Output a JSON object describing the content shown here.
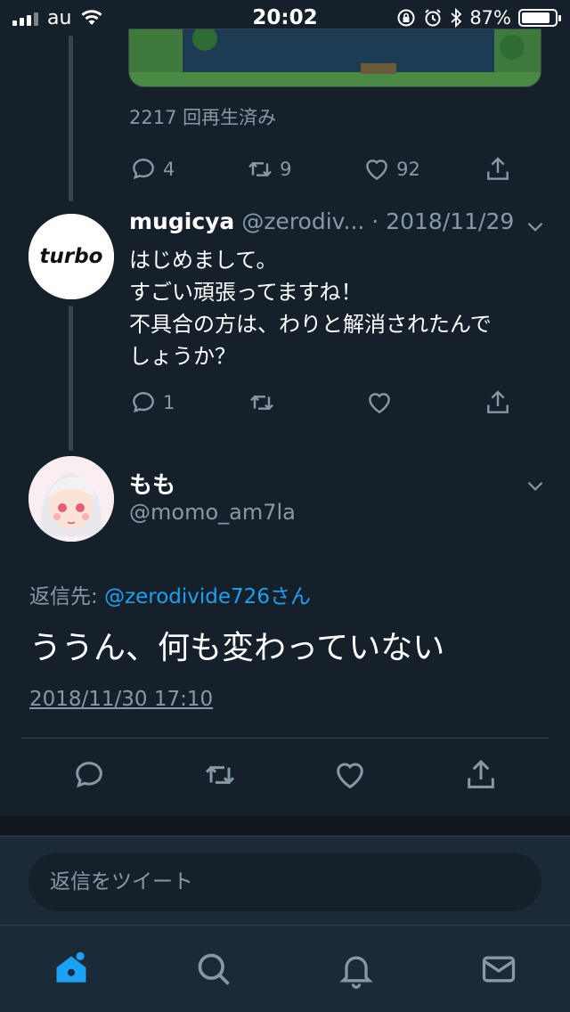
{
  "status_bar": {
    "carrier": "au",
    "time": "20:02",
    "battery": "87%",
    "battery_level": 0.87
  },
  "prev_tweet": {
    "views": "2217 回再生済み",
    "replies": "4",
    "retweets": "9",
    "likes": "92"
  },
  "reply_tweet": {
    "name": "mugicya",
    "meta": "@zerodiv... · 2018/11/29",
    "avatar_text": "turbo",
    "text": "はじめまして。\nすごい頑張ってますね！\n不具合の方は、わりと解消されたんで\nしょうか？",
    "replies": "1"
  },
  "main_tweet": {
    "name": "もも",
    "handle": "@momo_am7la",
    "reply_prefix": "返信先: ",
    "reply_link": "@zerodivide726さん",
    "text": "ううん、何も変わっていない",
    "timestamp": "2018/11/30 17:10"
  },
  "reply_bar": {
    "placeholder": "返信をツイート"
  },
  "tabs": [
    "home-icon",
    "search-icon",
    "notifications-icon",
    "messages-icon"
  ],
  "colors": {
    "background": "#15202b",
    "accent": "#1da1f2",
    "muted": "#8899a6"
  }
}
